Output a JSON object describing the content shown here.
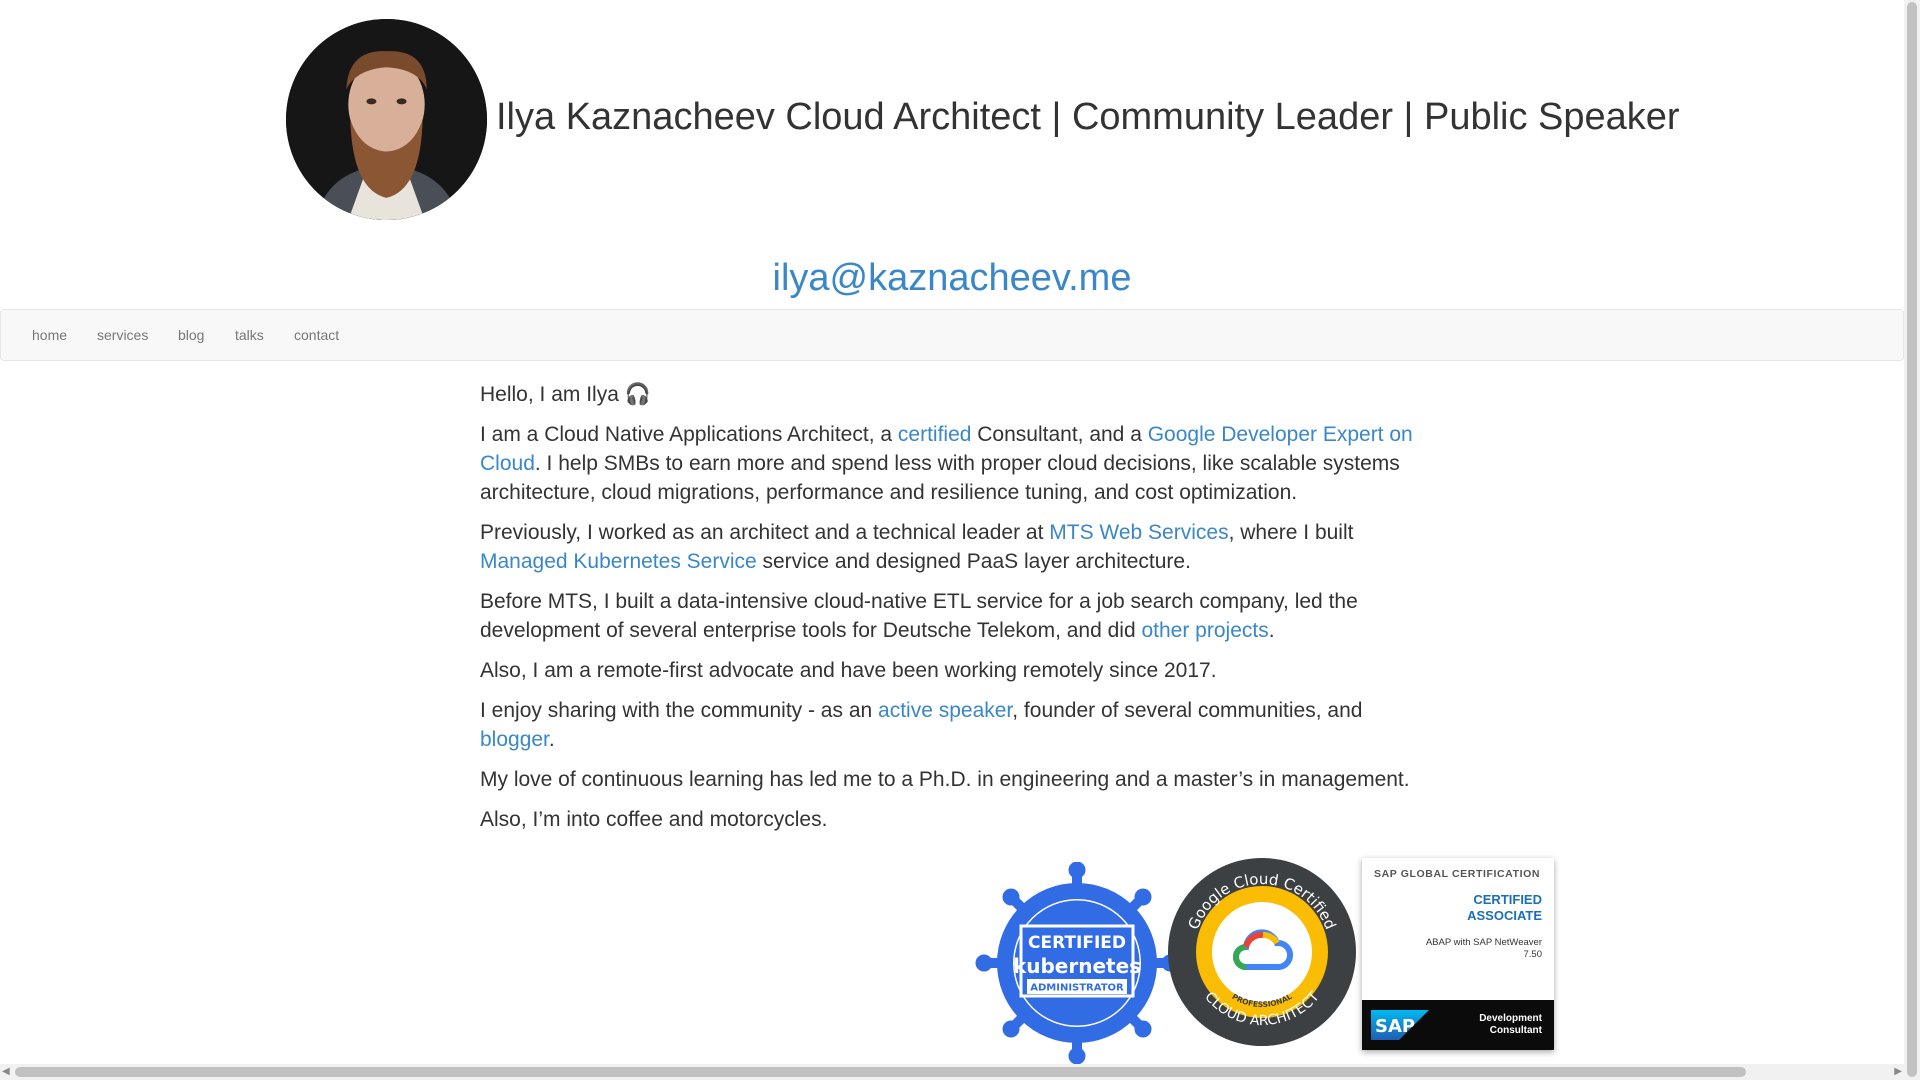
{
  "header": {
    "title": "Ilya Kaznacheev Cloud Architect | Community Leader | Public Speaker",
    "email": "ilya@kaznacheev.me"
  },
  "nav": {
    "items": [
      "home",
      "services",
      "blog",
      "talks",
      "contact"
    ]
  },
  "content": {
    "greeting": "Hello, I am Ilya 🎧",
    "p1": {
      "t1": "I am a Cloud Native Applications Architect, a ",
      "link1": "certified",
      "t2": " Consultant, and a ",
      "link2": "Google Developer Expert on Cloud",
      "t3": ". I help SMBs to earn more and spend less with proper cloud decisions, like scalable systems architecture, cloud migrations, performance and resilience tuning, and cost optimization."
    },
    "p2": {
      "t1": "Previously, I worked as an architect and a technical leader at ",
      "link1": "MTS Web Services",
      "t2": ", where I built ",
      "link2": "Managed Kubernetes Service",
      "t3": " service and designed PaaS layer architecture."
    },
    "p3": {
      "t1": "Before MTS, I built a data-intensive cloud-native ETL service for a job search company, led the development of several enterprise tools for Deutsche Telekom, and did ",
      "link1": "other projects",
      "t2": "."
    },
    "p4": "Also, I am a remote-first advocate and have been working remotely since 2017.",
    "p5": {
      "t1": "I enjoy sharing with the community - as an ",
      "link1": "active speaker",
      "t2": ", founder of several communities, and ",
      "link2": "blogger",
      "t3": "."
    },
    "p6": "My love of continuous learning has led me to a Ph.D. in engineering and a master’s in management.",
    "p7": "Also, I’m into coffee and motorcycles."
  },
  "badges": {
    "k8s": {
      "line1": "CERTIFIED",
      "line2": "kubernetes",
      "line3": "ADMINISTRATOR",
      "color": "#326ce5"
    },
    "gcp": {
      "ring_top": "Google Cloud Certified",
      "ring_bottom": "CLOUD ARCHITECT",
      "level": "PROFESSIONAL"
    },
    "sap": {
      "header": "SAP GLOBAL CERTIFICATION",
      "cert1": "CERTIFIED",
      "cert2": "ASSOCIATE",
      "sub1": "ABAP with SAP NetWeaver",
      "sub2": "7.50",
      "logo": "SAP",
      "foot1": "Development",
      "foot2": "Consultant"
    }
  },
  "colors": {
    "link": "#3a87c8",
    "text": "#333333",
    "nav_text": "#777777",
    "nav_bg": "#f8f8f8"
  }
}
